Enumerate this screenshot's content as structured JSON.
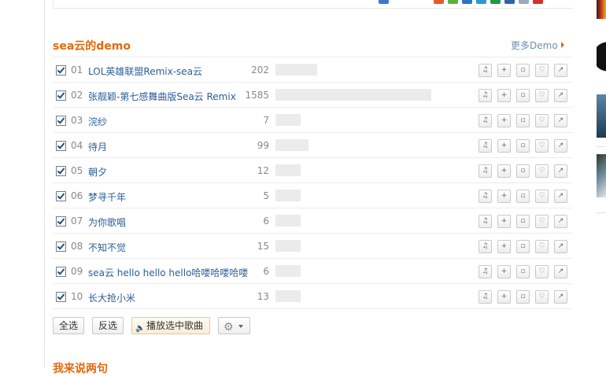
{
  "section": {
    "title": "sea云的demo",
    "more_label": "更多Demo"
  },
  "songs": [
    {
      "num": "01",
      "title": "LOL英雄联盟Remix-sea云",
      "plays": "202",
      "level": 0.27
    },
    {
      "num": "02",
      "title": "张靓颖-第七感舞曲版Sea云 Remix",
      "plays": "1585",
      "level": 1.0
    },
    {
      "num": "03",
      "title": "浣纱",
      "plays": "7",
      "level": 0.16
    },
    {
      "num": "04",
      "title": "待月",
      "plays": "99",
      "level": 0.21
    },
    {
      "num": "05",
      "title": "朝夕",
      "plays": "12",
      "level": 0.16
    },
    {
      "num": "06",
      "title": "梦寻千年",
      "plays": "5",
      "level": 0.16
    },
    {
      "num": "07",
      "title": "为你歌唱",
      "plays": "6",
      "level": 0.16
    },
    {
      "num": "08",
      "title": "不知不觉",
      "plays": "15",
      "level": 0.16
    },
    {
      "num": "09",
      "title": "sea云 hello hello hello哈喽哈喽哈喽",
      "plays": "6",
      "level": 0.16
    },
    {
      "num": "10",
      "title": "长大抢小米",
      "plays": "13",
      "level": 0.16
    }
  ],
  "row_actions": [
    "listen-icon",
    "add-icon",
    "download-icon",
    "like-icon",
    "share-icon"
  ],
  "toolbar": {
    "select_all": "全选",
    "invert": "反选",
    "play_selected": "播放选中歌曲"
  },
  "next_section": {
    "title": "我来说两句"
  },
  "colors": {
    "accent": "#e5690c",
    "link": "#2a5d99",
    "muted_link": "#6c8fb3"
  }
}
